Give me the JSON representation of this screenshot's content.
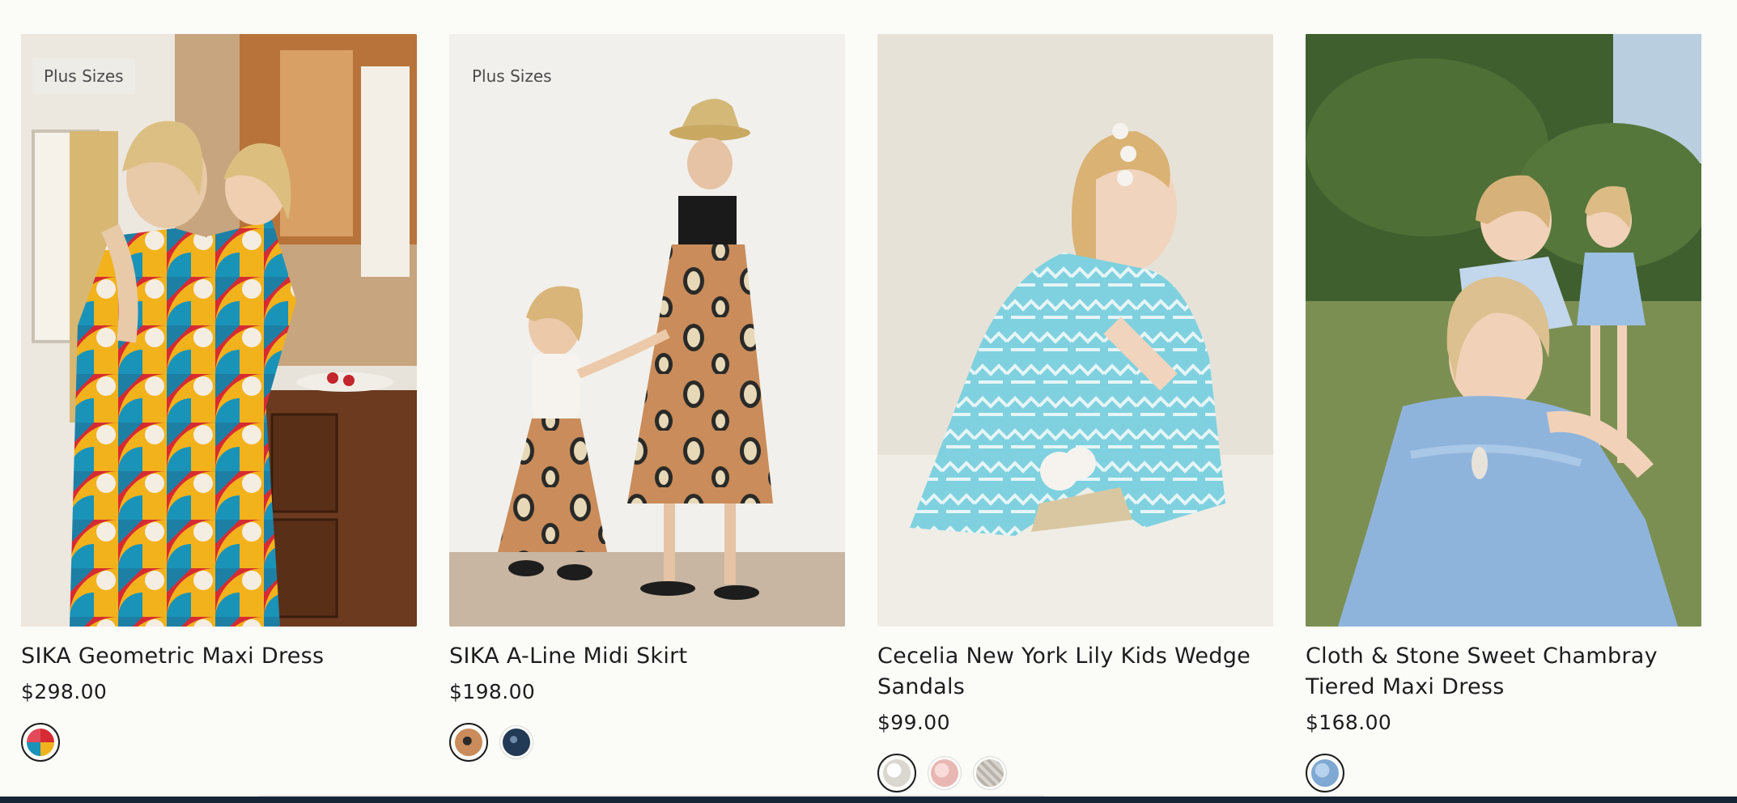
{
  "products": [
    {
      "badge": "Plus Sizes",
      "title": "SIKA Geometric Maxi Dress",
      "price": "$298.00",
      "image": "woman-and-girl-in-geometric-print-dresses-kitchen",
      "swatches": [
        {
          "color": "multicolor-geometric",
          "selected": true
        }
      ]
    },
    {
      "badge": "Plus Sizes",
      "title": "SIKA A-Line Midi Skirt",
      "price": "$198.00",
      "image": "woman-and-girl-in-zebra-print-skirts",
      "swatches": [
        {
          "color": "orange-zebra",
          "selected": true
        },
        {
          "color": "navy-print",
          "selected": false
        }
      ]
    },
    {
      "badge": "",
      "title": "Cecelia New York Lily Kids Wedge Sandals",
      "price": "$99.00",
      "image": "girl-in-aqua-dress-with-flower-wedge-sandals",
      "swatches": [
        {
          "color": "white",
          "selected": true
        },
        {
          "color": "pink",
          "selected": false
        },
        {
          "color": "silver",
          "selected": false
        }
      ]
    },
    {
      "badge": "",
      "title": "Cloth & Stone Sweet Chambray Tiered Maxi Dress",
      "price": "$168.00",
      "image": "woman-in-chambray-dress-with-children-outdoors",
      "swatches": [
        {
          "color": "chambray-blue",
          "selected": true
        }
      ]
    }
  ]
}
